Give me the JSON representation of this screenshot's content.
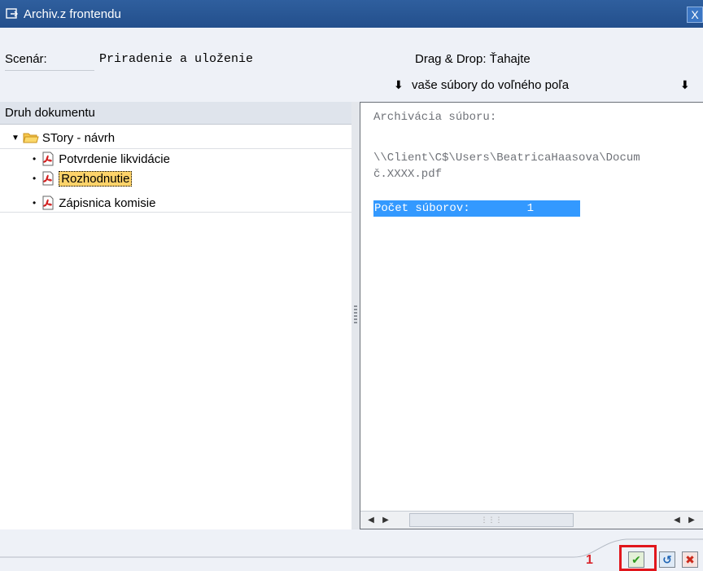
{
  "window": {
    "title": "Archiv.z frontendu",
    "close_label": "X",
    "icon": "external-link-icon"
  },
  "header": {
    "scenario_label": "Scenár:",
    "scenario_value": "Priradenie a uloženie",
    "dnd_title": "Drag & Drop: Ťahajte",
    "dnd_hint": "vaše súbory do voľného poľa",
    "arrow_glyph": "⬇"
  },
  "tree": {
    "header": "Druh dokumentu",
    "root": {
      "label": "STory - návrh",
      "icon": "folder-open-icon"
    },
    "items": [
      {
        "label": "Potvrdenie likvidácie",
        "icon": "pdf-icon",
        "selected": false
      },
      {
        "label": "Rozhodnutie",
        "icon": "pdf-icon",
        "selected": true
      },
      {
        "label": "Zápisnica komisie",
        "icon": "pdf-icon",
        "selected": false
      }
    ]
  },
  "archive": {
    "heading": "Archivácia súboru:",
    "path_line1": "\\\\Client\\C$\\Users\\BeatricaHaasova\\Docum",
    "path_line2": "č.XXXX.pdf",
    "count_label": "Počet súborov:",
    "count_value": "1"
  },
  "footer": {
    "step_number": "1",
    "ok_icon": "checkmark-icon",
    "help_icon": "refresh-help-icon",
    "cancel_icon": "cancel-icon"
  },
  "colors": {
    "titlebar": "#2f5f9e",
    "selection": "#3399ff",
    "selected_item": "#fdd36a",
    "annotation_red": "#e1161c"
  }
}
